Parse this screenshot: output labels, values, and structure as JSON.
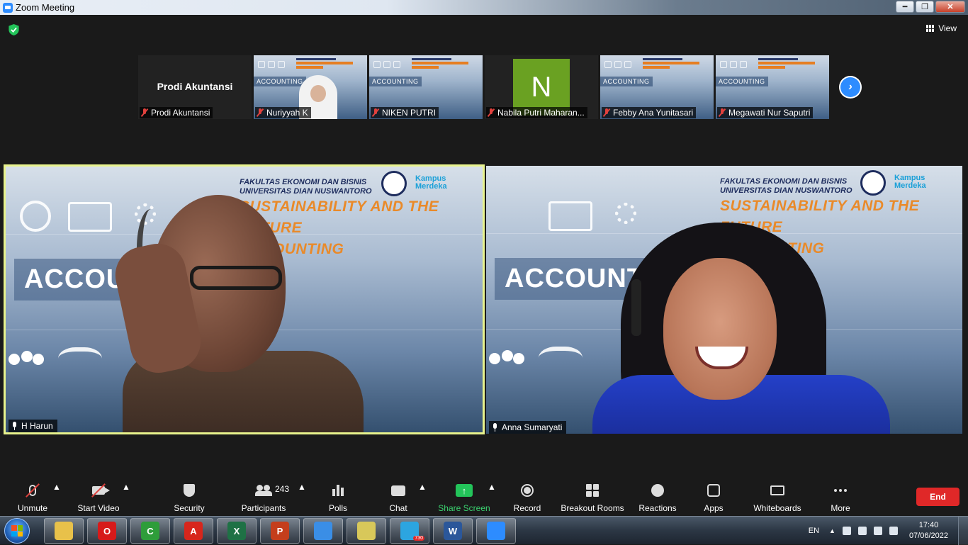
{
  "window": {
    "title": "Zoom Meeting",
    "controls": [
      "minimize",
      "maximize",
      "close"
    ]
  },
  "top": {
    "security_icon": "green-shield-icon",
    "view_label": "View"
  },
  "thumbnails": [
    {
      "name": "Prodi Akuntansi",
      "display": "Prodi Akuntansi",
      "type": "text",
      "muted": true
    },
    {
      "name": "Nuriyyah K",
      "type": "video",
      "muted": true
    },
    {
      "name": "NIKEN PUTRI",
      "type": "slide",
      "muted": true
    },
    {
      "name": "Nabila Putri Maharan...",
      "type": "avatar",
      "letter": "N",
      "avatar_color": "#6aa122",
      "muted": true
    },
    {
      "name": "Febby Ana Yunitasari",
      "type": "slide",
      "muted": true
    },
    {
      "name": "Megawati Nur Saputri",
      "type": "slide",
      "muted": true
    }
  ],
  "slide": {
    "faculty_line1": "FAKULTAS EKONOMI DAN BISNIS",
    "faculty_line2": "UNIVERSITAS DIAN NUSWANTORO",
    "headline1": "SUSTAINABILITY AND THE FUTURE",
    "headline2": "ACCOUNTING",
    "big_word": "ACCOUNTING",
    "partner_logo_line1": "Kampus",
    "partner_logo_line2": "Merdeka"
  },
  "videos": [
    {
      "name": "H Harun",
      "active_speaker": true
    },
    {
      "name": "Anna Sumaryati",
      "active_speaker": false
    }
  ],
  "toolbar": {
    "unmute": "Unmute",
    "start_video": "Start Video",
    "security": "Security",
    "participants": "Participants",
    "participant_count": "243",
    "polls": "Polls",
    "chat": "Chat",
    "share_screen": "Share Screen",
    "record": "Record",
    "breakout_rooms": "Breakout Rooms",
    "reactions": "Reactions",
    "apps": "Apps",
    "whiteboards": "Whiteboards",
    "more": "More",
    "end": "End"
  },
  "taskbar": {
    "apps": [
      {
        "name": "explorer",
        "color": "#e8c14a",
        "label": ""
      },
      {
        "name": "opera",
        "color": "#d71a1a",
        "label": "O"
      },
      {
        "name": "camtasia",
        "color": "#2e9d3a",
        "label": "C"
      },
      {
        "name": "acrobat",
        "color": "#d7261c",
        "label": "A"
      },
      {
        "name": "excel",
        "color": "#1e7145",
        "label": "X"
      },
      {
        "name": "powerpoint",
        "color": "#c43e1c",
        "label": "P"
      },
      {
        "name": "chrome",
        "color": "#3a8ee6",
        "label": ""
      },
      {
        "name": "sticky-notes",
        "color": "#d8c85a",
        "label": ""
      },
      {
        "name": "telegram",
        "color": "#2ca5e0",
        "label": "",
        "badge": "730"
      },
      {
        "name": "word",
        "color": "#2b579a",
        "label": "W"
      },
      {
        "name": "zoom",
        "color": "#2d8cff",
        "label": ""
      }
    ],
    "lang": "EN",
    "time": "17:40",
    "date": "07/06/2022"
  }
}
